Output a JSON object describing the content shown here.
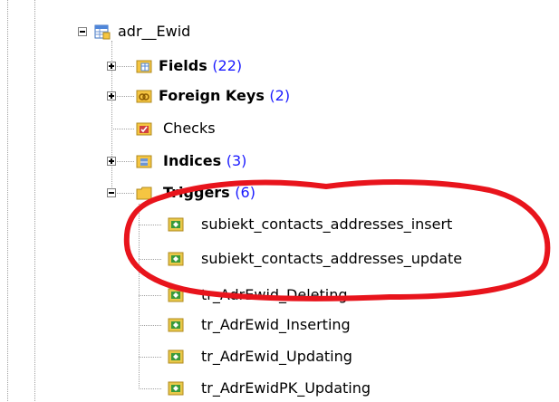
{
  "tree": {
    "table": {
      "name": "adr__Ewid"
    },
    "groups": [
      {
        "label": "Fields",
        "count": "(22)",
        "bold": true,
        "expander": "plus"
      },
      {
        "label": "Foreign Keys",
        "count": "(2)",
        "bold": true,
        "expander": "plus"
      },
      {
        "label": "Checks",
        "count": "",
        "bold": false,
        "expander": "none"
      },
      {
        "label": "Indices",
        "count": "(3)",
        "bold": true,
        "expander": "plus"
      },
      {
        "label": "Triggers",
        "count": "(6)",
        "bold": true,
        "expander": "minus"
      }
    ],
    "triggers": [
      "subiekt_contacts_addresses_insert",
      "subiekt_contacts_addresses_update",
      "tr_AdrEwid_Deleting",
      "tr_AdrEwid_Inserting",
      "tr_AdrEwid_Updating",
      "tr_AdrEwidPK_Updating"
    ]
  },
  "colors": {
    "highlight": "#e8141c",
    "count": "#1a1aff",
    "folder": "#f5c542",
    "trigger_icon": "#3a9a3a"
  }
}
